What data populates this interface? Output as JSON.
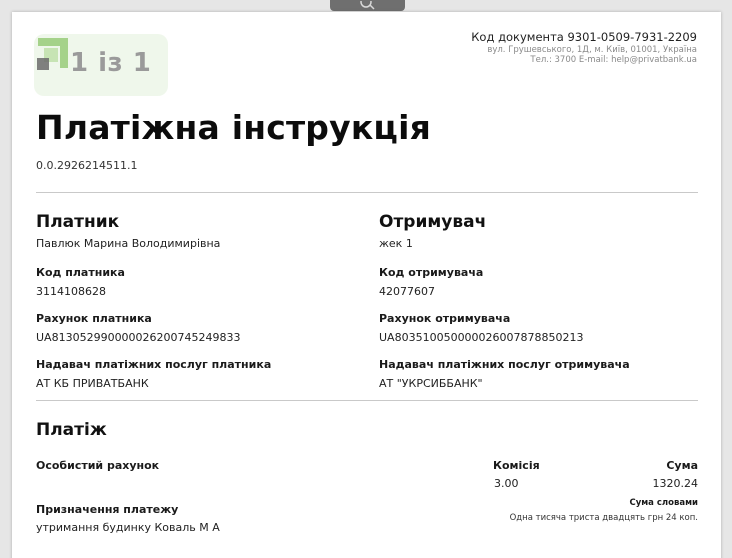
{
  "toolbar": {
    "icon": "search-icon"
  },
  "header": {
    "logo_icon": "privatbank-logo-icon",
    "page_counter": "1 із 1",
    "doc_code": "Код документа 9301-0509-7931-2209",
    "address_line1": "вул. Грушевського, 1Д, м. Київ, 01001, Україна",
    "address_line2": "Тел.: 3700  E-mail: help@privatbank.ua"
  },
  "document": {
    "title": "Платіжна інструкція",
    "number": "0.0.2926214511.1"
  },
  "payer": {
    "heading": "Платник",
    "name": "Павлюк Марина Володимирівна",
    "code_label": "Код платника",
    "code": "3114108628",
    "account_label": "Рахунок платника",
    "account": "UA813052990000026200745249833",
    "provider_label": "Надавач платіжних послуг платника",
    "provider": "АТ КБ ПРИВАТБАНК"
  },
  "receiver": {
    "heading": "Отримувач",
    "name": "жек 1",
    "code_label": "Код отримувача",
    "code": "42077607",
    "account_label": "Рахунок отримувача",
    "account": "UA803510050000026007878850213",
    "provider_label": "Надавач платіжних послуг отримувача",
    "provider": "АТ \"УКРСИББАНК\""
  },
  "payment": {
    "heading": "Платіж",
    "personal_account_label": "Особистий рахунок",
    "commission_label": "Комісія",
    "commission": "3.00",
    "amount_label": "Сума",
    "amount": "1320.24",
    "amount_words_label": "Сума словами",
    "amount_words": "Одна тисяча триста двадцять грн 24 коп.",
    "purpose_label": "Призначення платежу",
    "purpose": "утримання будинку Коваль М А"
  }
}
